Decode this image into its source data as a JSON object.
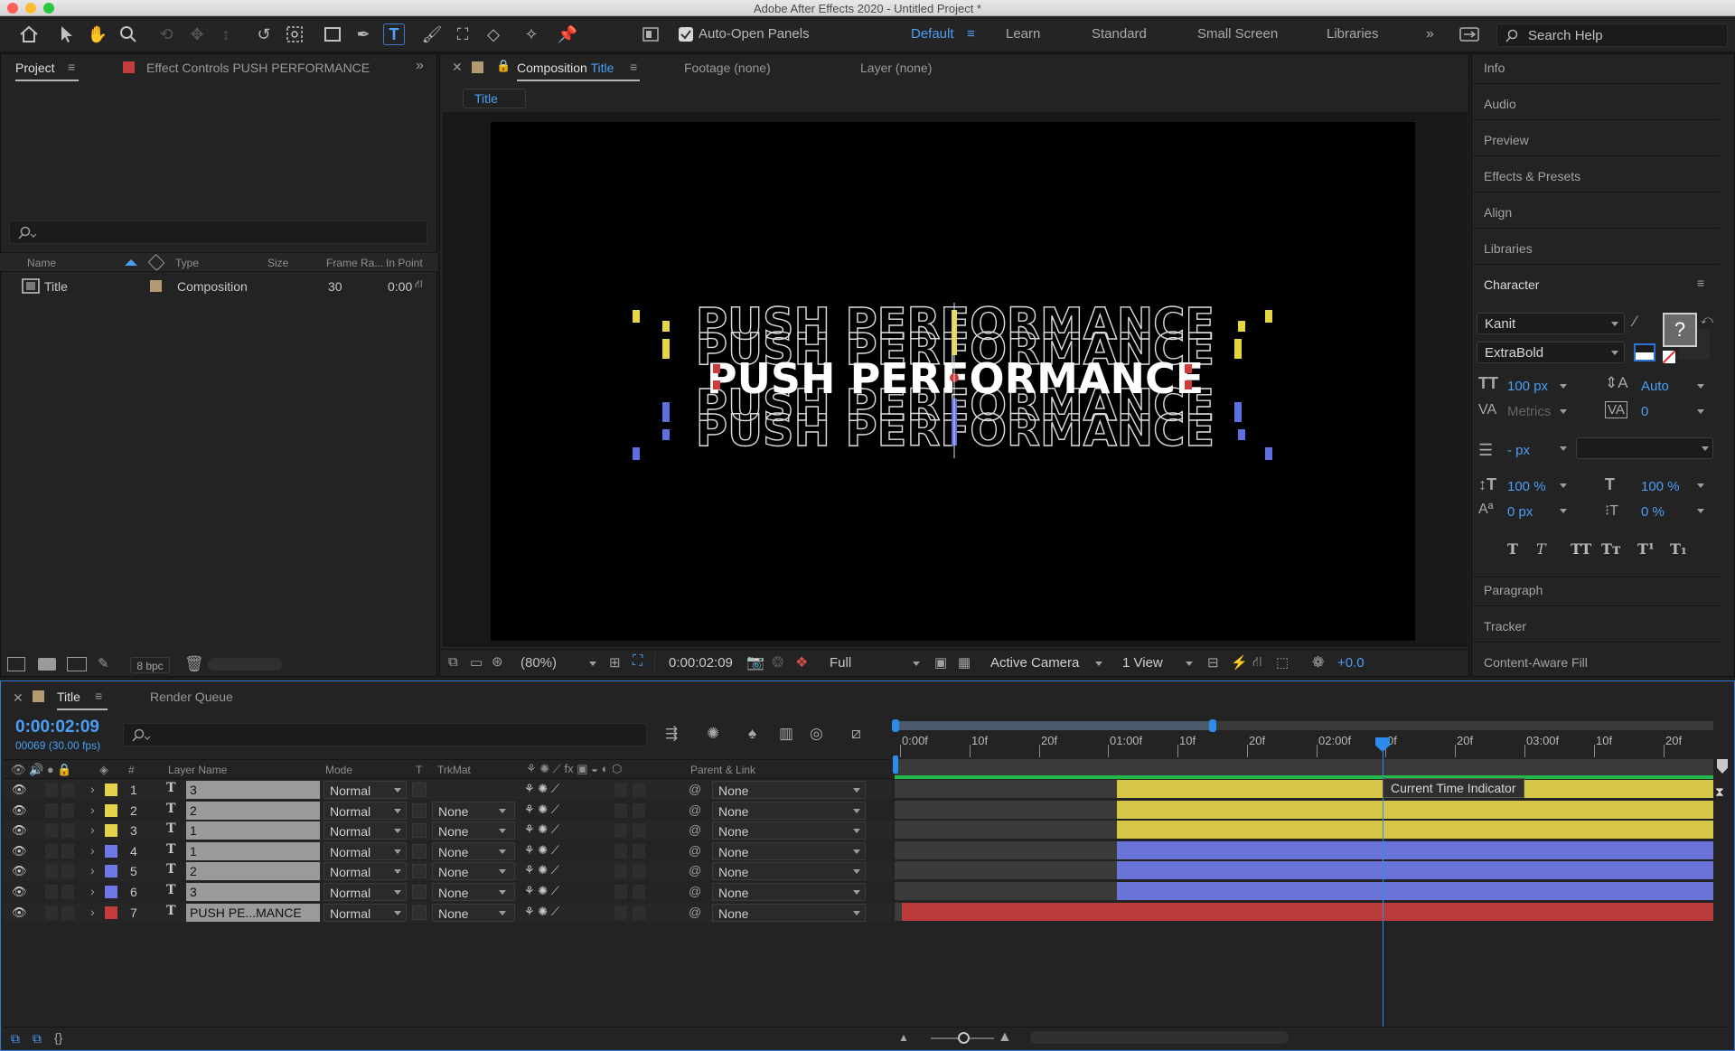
{
  "app": {
    "window_title": "Adobe After Effects 2020 - Untitled Project *"
  },
  "toolbar": {
    "auto_open_panels": "Auto-Open Panels",
    "workspaces": [
      "Default",
      "Learn",
      "Standard",
      "Small Screen",
      "Libraries"
    ],
    "active_workspace": "Default",
    "search_help": "Search Help"
  },
  "project_panel": {
    "tab_project": "Project",
    "tab_effect_controls": "Effect Controls PUSH PERFORMANCE",
    "columns": [
      "Name",
      "Type",
      "Size",
      "Frame Ra...",
      "In Point"
    ],
    "items": [
      {
        "name": "Title",
        "type": "Composition",
        "size": "",
        "frame_rate": "30",
        "in_point": "0:00"
      }
    ],
    "bpc": "8 bpc"
  },
  "comp_panel": {
    "tab_composition": "Composition",
    "tab_composition_name": "Title",
    "tab_footage": "Footage (none)",
    "tab_layer": "Layer (none)",
    "breadcrumb": "Title",
    "canvas_text": "PUSH PERFORMANCE",
    "zoom": "(80%)",
    "timecode": "0:00:02:09",
    "resolution": "Full",
    "camera": "Active Camera",
    "views": "1 View",
    "exposure": "+0.0"
  },
  "right_panels": {
    "info": "Info",
    "audio": "Audio",
    "preview": "Preview",
    "effects_presets": "Effects & Presets",
    "align": "Align",
    "libraries": "Libraries",
    "character": "Character",
    "paragraph": "Paragraph",
    "tracker": "Tracker",
    "content_aware_fill": "Content-Aware Fill"
  },
  "character": {
    "font": "Kanit",
    "style": "ExtraBold",
    "size": "100 px",
    "leading": "Auto",
    "kerning": "Metrics",
    "tracking": "0",
    "stroke": "- px",
    "vscale": "100 %",
    "hscale": "100 %",
    "baseline": "0 px",
    "tsume": "0 %",
    "styles": [
      "T",
      "T",
      "TT",
      "Tт",
      "T¹",
      "T₁"
    ]
  },
  "timeline": {
    "tab_title": "Title",
    "tab_render_queue": "Render Queue",
    "timecode": "0:00:02:09",
    "frames": "00069 (30.00 fps)",
    "columns": {
      "num": "#",
      "layer_name": "Layer Name",
      "mode": "Mode",
      "t": "T",
      "trkmat": "TrkMat",
      "parent": "Parent & Link"
    },
    "ruler": [
      "0:00f",
      "10f",
      "20f",
      "01:00f",
      "10f",
      "20f",
      "02:00f",
      "0f",
      "20f",
      "03:00f",
      "10f",
      "20f"
    ],
    "cti_tooltip": "Current Time Indicator",
    "layers": [
      {
        "num": "1",
        "name": "3",
        "mode": "Normal",
        "trkmat": "",
        "parent": "None",
        "color": "#e4d24a"
      },
      {
        "num": "2",
        "name": "2",
        "mode": "Normal",
        "trkmat": "None",
        "parent": "None",
        "color": "#e4d24a"
      },
      {
        "num": "3",
        "name": "1",
        "mode": "Normal",
        "trkmat": "None",
        "parent": "None",
        "color": "#e4d24a"
      },
      {
        "num": "4",
        "name": "1",
        "mode": "Normal",
        "trkmat": "None",
        "parent": "None",
        "color": "#6f78e6"
      },
      {
        "num": "5",
        "name": "2",
        "mode": "Normal",
        "trkmat": "None",
        "parent": "None",
        "color": "#6f78e6"
      },
      {
        "num": "6",
        "name": "3",
        "mode": "Normal",
        "trkmat": "None",
        "parent": "None",
        "color": "#6f78e6"
      },
      {
        "num": "7",
        "name": "PUSH PE...MANCE",
        "mode": "Normal",
        "trkmat": "None",
        "parent": "None",
        "color": "#c43c3c"
      }
    ]
  },
  "colors": {
    "accent_blue": "#2d8ceb",
    "yellow_label": "#e4d24a",
    "blue_label": "#6f78e6",
    "red_label": "#c43c3c",
    "tan_label": "#b49a72"
  }
}
